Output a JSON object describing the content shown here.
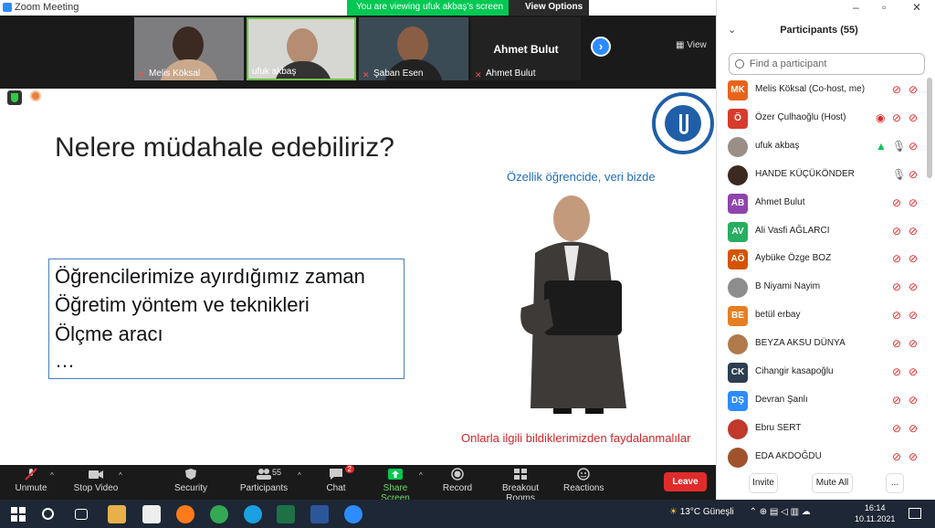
{
  "window": {
    "title": "Zoom Meeting"
  },
  "share_banner": {
    "viewing": "You are viewing ufuk akbaş's screen",
    "view_options": "View Options"
  },
  "thumbnails": [
    {
      "name": "Melis Köksal"
    },
    {
      "name": "ufuk akbaş"
    },
    {
      "name": "Şaban Esen"
    },
    {
      "name": "Ahmet Bulut",
      "display": "Ahmet Bulut"
    }
  ],
  "view_label": "View",
  "slide": {
    "title": "Nelere müdahale edebiliriz?",
    "bullets": [
      "Öğrencilerimize ayırdığımız zaman",
      "Öğretim yöntem ve teknikleri",
      "Ölçme aracı",
      "…"
    ],
    "caption_top": "Özellik öğrencide, veri bizde",
    "caption_bottom": "Onlarla ilgili bildiklerimizden faydalanmalılar"
  },
  "toolbar": {
    "unmute": "Unmute",
    "stop_video": "Stop Video",
    "security": "Security",
    "participants": "Participants",
    "participants_count": "55",
    "chat": "Chat",
    "chat_badge": "2",
    "share_screen": "Share Screen",
    "record": "Record",
    "breakout": "Breakout Rooms",
    "reactions": "Reactions",
    "leave": "Leave"
  },
  "panel": {
    "title": "Participants (55)",
    "search_placeholder": "Find a participant",
    "participants": [
      {
        "initials": "MK",
        "name": "Melis Köksal (Co-host, me)",
        "color": "#e8641b"
      },
      {
        "initials": "Ö",
        "name": "Özer Çulhaoğlu (Host)",
        "color": "#d83b2b"
      },
      {
        "initials": "",
        "name": "ufuk akbaş",
        "color": "#9a8f86"
      },
      {
        "initials": "",
        "name": "HANDE KÜÇÜKÖNDER",
        "color": "#3b2a20"
      },
      {
        "initials": "AB",
        "name": "Ahmet Bulut",
        "color": "#8e44ad"
      },
      {
        "initials": "AV",
        "name": "Ali Vasfi AĞLARCI",
        "color": "#27ae60"
      },
      {
        "initials": "AÖ",
        "name": "Aybüke Özge BOZ",
        "color": "#d35400"
      },
      {
        "initials": "",
        "name": "B Niyami Nayim",
        "color": "#8d8d8d"
      },
      {
        "initials": "BE",
        "name": "betül erbay",
        "color": "#e67e22"
      },
      {
        "initials": "",
        "name": "BEYZA AKSU DÜNYA",
        "color": "#b07a4a"
      },
      {
        "initials": "CK",
        "name": "Cihangir kasapoğlu",
        "color": "#2c3e50"
      },
      {
        "initials": "DŞ",
        "name": "Devran Şanlı",
        "color": "#2d8cff"
      },
      {
        "initials": "",
        "name": "Ebru SERT",
        "color": "#c0392b"
      },
      {
        "initials": "",
        "name": "EDA AKDOĞDU",
        "color": "#a0522d"
      }
    ],
    "invite": "Invite",
    "mute_all": "Mute All",
    "more": "..."
  },
  "taskbar": {
    "weather": "13°C  Güneşli",
    "time": "16:14",
    "date": "10.11.2021"
  }
}
